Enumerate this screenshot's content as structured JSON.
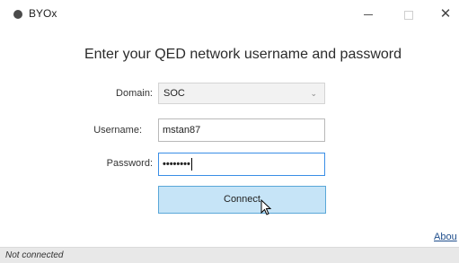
{
  "window": {
    "title": "BYOx",
    "controls": {
      "minimize": "–",
      "maximize": "□",
      "close": "✕"
    }
  },
  "heading": "Enter your QED network username and password",
  "form": {
    "domain_label": "Domain:",
    "domain_value": "SOC",
    "username_label": "Username:",
    "username_value": "mstan87",
    "password_label": "Password:",
    "password_masked": "••••••••",
    "connect_label": "Connect"
  },
  "links": {
    "about": "Abou"
  },
  "status": {
    "text": "Not connected"
  },
  "colors": {
    "button_bg": "#c6e4f7",
    "button_border": "#5aa7d8",
    "focus_border": "#3a8ee6",
    "statusbar_bg": "#e8e8e8"
  },
  "icons": {
    "app": "circle-icon",
    "select": "chevron-down-icon",
    "pointer": "mouse-pointer-icon"
  }
}
